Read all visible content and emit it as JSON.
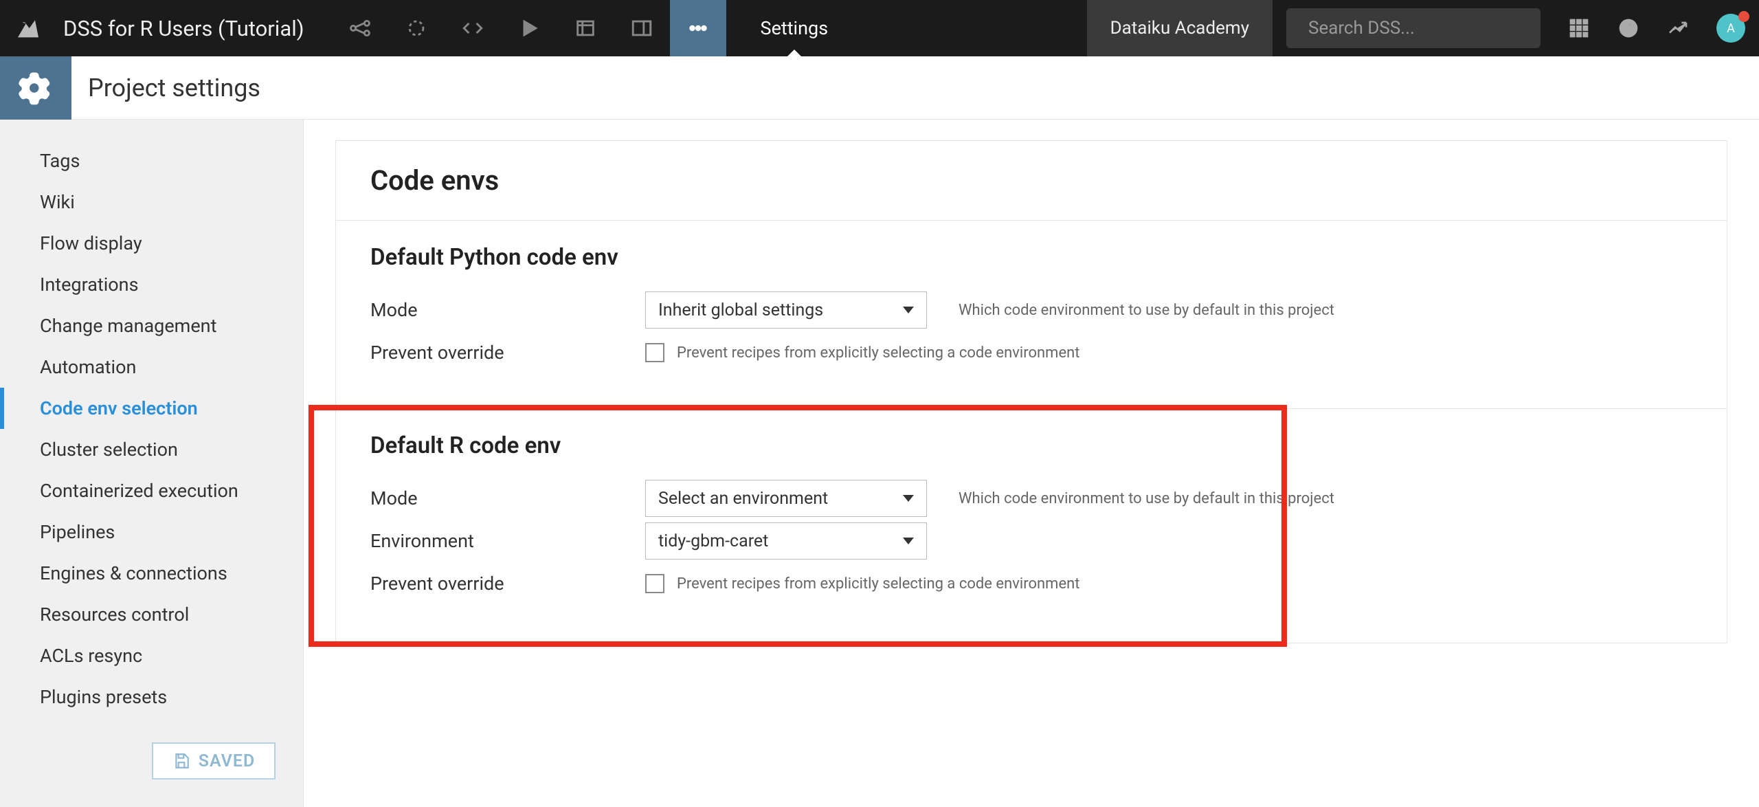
{
  "topbar": {
    "project_title": "DSS for R Users (Tutorial)",
    "active_tab": "Settings",
    "academy_label": "Dataiku Academy",
    "search_placeholder": "Search DSS..."
  },
  "subheader": {
    "title": "Project settings"
  },
  "sidebar": {
    "items": [
      {
        "label": "Tags",
        "active": false
      },
      {
        "label": "Wiki",
        "active": false
      },
      {
        "label": "Flow display",
        "active": false
      },
      {
        "label": "Integrations",
        "active": false
      },
      {
        "label": "Change management",
        "active": false
      },
      {
        "label": "Automation",
        "active": false
      },
      {
        "label": "Code env selection",
        "active": true
      },
      {
        "label": "Cluster selection",
        "active": false
      },
      {
        "label": "Containerized execution",
        "active": false
      },
      {
        "label": "Pipelines",
        "active": false
      },
      {
        "label": "Engines & connections",
        "active": false
      },
      {
        "label": "Resources control",
        "active": false
      },
      {
        "label": "ACLs resync",
        "active": false
      },
      {
        "label": "Plugins presets",
        "active": false
      }
    ],
    "save_label": "SAVED"
  },
  "main": {
    "page_title": "Code envs",
    "python": {
      "heading": "Default Python code env",
      "mode_label": "Mode",
      "mode_value": "Inherit global settings",
      "mode_hint": "Which code environment to use by default in this project",
      "prevent_label": "Prevent override",
      "prevent_hint": "Prevent recipes from explicitly selecting a code environment"
    },
    "r": {
      "heading": "Default R code env",
      "mode_label": "Mode",
      "mode_value": "Select an environment",
      "mode_hint": "Which code environment to use by default in this project",
      "env_label": "Environment",
      "env_value": "tidy-gbm-caret",
      "prevent_label": "Prevent override",
      "prevent_hint": "Prevent recipes from explicitly selecting a code environment"
    }
  }
}
